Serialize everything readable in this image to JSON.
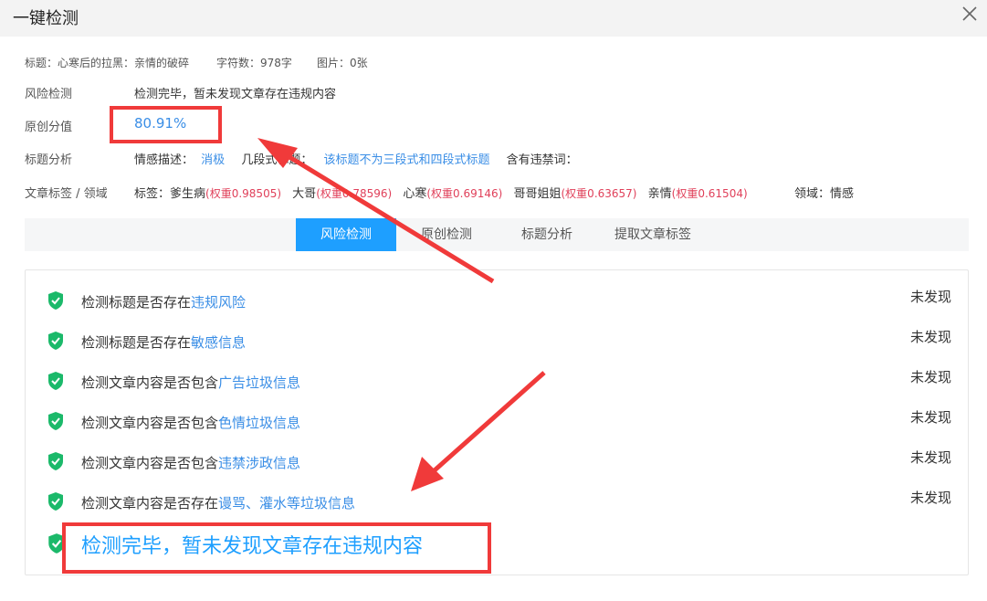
{
  "dialog": {
    "title": "一键检测"
  },
  "meta": {
    "title": "标题：心寒后的拉黑：亲情的破碎",
    "chars": "字符数：978字",
    "images": "图片：0张"
  },
  "risk": {
    "label": "风险检测",
    "value": "检测完毕，暂未发现文章存在违规内容"
  },
  "original": {
    "label": "原创分值",
    "value": "80.91%"
  },
  "title_analysis": {
    "label": "标题分析",
    "emotion_label": "情感描述：",
    "emotion_value": "消极",
    "format_label": "几段式标题：",
    "format_value": "该标题不为三段式和四段式标题",
    "banned_label": "含有违禁词："
  },
  "tags": {
    "label": "文章标签 / 领域",
    "prefix": "标签：",
    "items": [
      {
        "name": "爹生病",
        "weight": "(权重0.98505)"
      },
      {
        "name": "大哥",
        "weight": "(权重0.78596)"
      },
      {
        "name": "心寒",
        "weight": "(权重0.69146)"
      },
      {
        "name": "哥哥姐姐",
        "weight": "(权重0.63657)"
      },
      {
        "name": "亲情",
        "weight": "(权重0.61504)"
      }
    ],
    "domain": "领域：情感"
  },
  "tabs": [
    {
      "label": "风险检测",
      "active": true
    },
    {
      "label": "原创检测"
    },
    {
      "label": "标题分析"
    },
    {
      "label": "提取文章标签"
    }
  ],
  "checks": [
    {
      "prefix": "检测标题是否存在",
      "highlight": "违规风险",
      "status": "未发现"
    },
    {
      "prefix": "检测标题是否存在",
      "highlight": "敏感信息",
      "status": "未发现"
    },
    {
      "prefix": "检测文章内容是否包含",
      "highlight": "广告垃圾信息",
      "status": "未发现"
    },
    {
      "prefix": "检测文章内容是否包含",
      "highlight": "色情垃圾信息",
      "status": "未发现"
    },
    {
      "prefix": "检测文章内容是否包含",
      "highlight": "违禁涉政信息",
      "status": "未发现"
    },
    {
      "prefix": "检测文章内容是否存在",
      "highlight": "谩骂、灌水等垃圾信息",
      "status": "未发现"
    }
  ],
  "final_message": "检测完毕，暂未发现文章存在违规内容",
  "colors": {
    "accent": "#1e9fff",
    "link": "#3a8ee6",
    "weight": "#e0405a",
    "shield": "#1bb96a",
    "annotation": "#f03a3a"
  },
  "icons": {
    "close": "close-icon",
    "check": "shield-check-icon"
  }
}
